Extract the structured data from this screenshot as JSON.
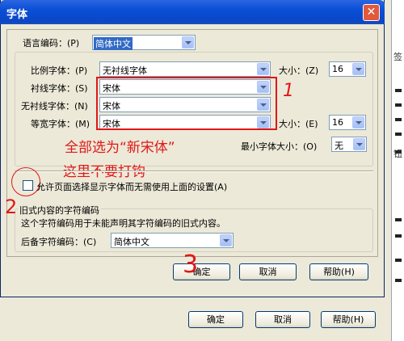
{
  "dialog": {
    "title": "字体",
    "close_glyph": "✕",
    "language": {
      "label": "语言编码：(P)",
      "value": "简体中文"
    },
    "proportional": {
      "label": "比例字体：(P)",
      "value": "无衬线字体",
      "size_label": "大小：(Z)",
      "size_value": "16"
    },
    "serif": {
      "label": "衬线字体：(S)",
      "value": "宋体"
    },
    "sans_serif": {
      "label": "无衬线字体：(N)",
      "value": "宋体"
    },
    "monospace": {
      "label": "等宽字体：(M)",
      "value": "宋体",
      "size_label": "大小：(E)",
      "size_value": "16"
    },
    "min_size": {
      "label": "最小字体大小：(O)",
      "value": "无"
    },
    "allow_pages": {
      "label": "允许页面选择显示字体而无需使用上面的设置(A)",
      "checked": false
    },
    "legacy": {
      "group_title": "旧式内容的字符编码",
      "description": "这个字符编码用于未能声明其字符编码的旧式内容。",
      "fallback_label": "后备字符编码：(C)",
      "fallback_value": "简体中文"
    },
    "buttons": {
      "ok": "确定",
      "cancel": "取消",
      "help": "帮助(H)"
    }
  },
  "background_window": {
    "buttons": {
      "ok": "确定",
      "cancel": "取消",
      "help": "帮助(H)"
    },
    "side_text_1": "签",
    "side_text_2": "钮"
  },
  "annotations": {
    "mark_1": "1",
    "mark_2": "2",
    "mark_3": "3",
    "all_select": "全部选为“新宋体”",
    "no_check": "这里不要打钩"
  },
  "colors": {
    "title_bar": "#0a4fd6",
    "annotation_red": "#e01818",
    "dialog_bg": "#ece9d8"
  }
}
